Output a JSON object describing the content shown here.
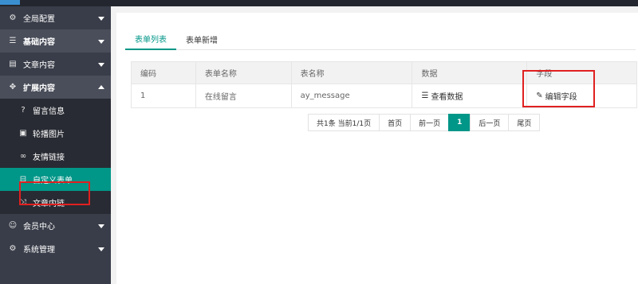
{
  "sidebar": {
    "groups": [
      {
        "label": "全局配置",
        "icon": "gear-icon"
      },
      {
        "label": "基础内容",
        "icon": "sliders-icon"
      },
      {
        "label": "文章内容",
        "icon": "file-icon"
      },
      {
        "label": "扩展内容",
        "icon": "puzzle-icon"
      }
    ],
    "sub_items": [
      {
        "label": "留言信息",
        "icon": "question-circle-icon"
      },
      {
        "label": "轮播图片",
        "icon": "image-icon"
      },
      {
        "label": "友情链接",
        "icon": "link-icon"
      },
      {
        "label": "自定义表单",
        "icon": "form-icon"
      },
      {
        "label": "文章内链",
        "icon": "shuffle-icon"
      }
    ],
    "groups_after": [
      {
        "label": "会员中心",
        "icon": "user-icon"
      },
      {
        "label": "系统管理",
        "icon": "gear-icon"
      }
    ]
  },
  "tabs": [
    {
      "label": "表单列表"
    },
    {
      "label": "表单新增"
    }
  ],
  "table": {
    "headers": [
      "编码",
      "表单名称",
      "表名称",
      "数据",
      "字段"
    ],
    "rows": [
      {
        "code": "1",
        "form_name": "在线留言",
        "table_name": "ay_message",
        "data_link": "查看数据",
        "field_link": "编辑字段"
      }
    ]
  },
  "pagination": {
    "summary": "共1条 当前1/1页",
    "first": "首页",
    "prev": "前一页",
    "current": "1",
    "next": "后一页",
    "last": "尾页"
  },
  "colors": {
    "accent": "#009688",
    "sidebar_bg": "#393d49",
    "highlight": "#e02020"
  }
}
